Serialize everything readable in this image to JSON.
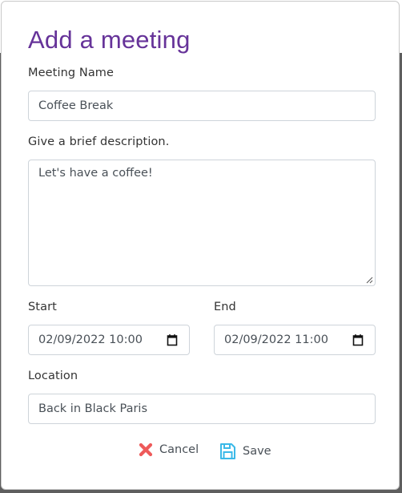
{
  "dialog": {
    "title": "Add a meeting",
    "colors": {
      "title": "#663399",
      "cancel_icon": "#ee5a5a",
      "save_icon": "#3bb9e8"
    }
  },
  "form": {
    "name": {
      "label": "Meeting Name",
      "value": "Coffee Break"
    },
    "description": {
      "label": "Give a brief description.",
      "value": "Let's have a coffee!"
    },
    "start": {
      "label": "Start",
      "value": "02/09/2022 10:00",
      "icon": "calendar-icon"
    },
    "end": {
      "label": "End",
      "value": "02/09/2022 11:00",
      "icon": "calendar-icon"
    },
    "location": {
      "label": "Location",
      "value": "Back in Black Paris"
    }
  },
  "actions": {
    "cancel": {
      "label": "Cancel",
      "icon": "close-x-icon"
    },
    "save": {
      "label": "Save",
      "icon": "floppy-disk-icon"
    }
  }
}
